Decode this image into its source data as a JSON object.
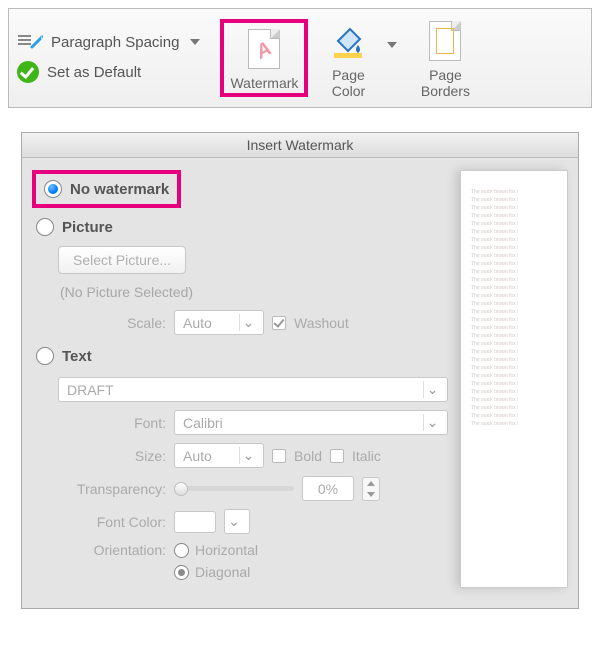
{
  "ribbon": {
    "paragraph_spacing_label": "Paragraph Spacing",
    "set_as_default_label": "Set as Default",
    "watermark_label": "Watermark",
    "page_color_label": "Page Color",
    "page_borders_label": "Page Borders"
  },
  "dialog": {
    "title": "Insert Watermark",
    "no_watermark_label": "No watermark",
    "picture_label": "Picture",
    "select_picture_btn": "Select Picture...",
    "no_picture_selected": "(No Picture Selected)",
    "scale_label": "Scale:",
    "scale_value": "Auto",
    "washout_label": "Washout",
    "text_label": "Text",
    "text_value": "DRAFT",
    "font_label": "Font:",
    "font_value": "Calibri",
    "size_label": "Size:",
    "size_value": "Auto",
    "bold_label": "Bold",
    "italic_label": "Italic",
    "transparency_label": "Transparency:",
    "transparency_value": "0%",
    "font_color_label": "Font Color:",
    "orientation_label": "Orientation:",
    "orientation_horizontal": "Horizontal",
    "orientation_diagonal": "Diagonal",
    "preview_line": "The quick brown fox j"
  }
}
